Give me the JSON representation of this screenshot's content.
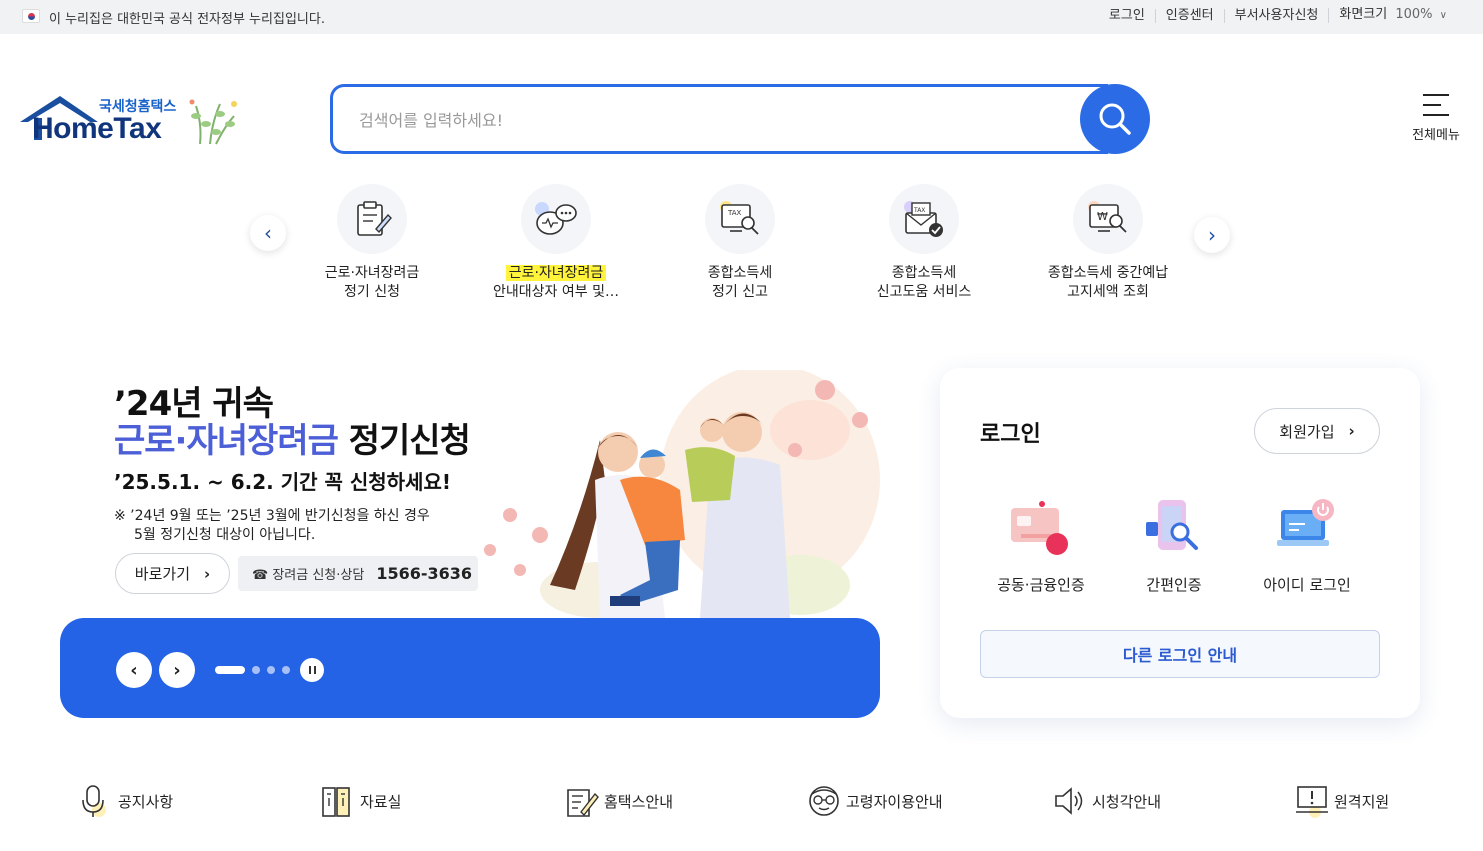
{
  "topbar": {
    "gov_notice": "이 누리집은 대한민국 공식 전자정부 누리집입니다.",
    "links": [
      "로그인",
      "인증센터",
      "부서사용자신청"
    ],
    "screen_size_label": "화면크기",
    "zoom": "100%"
  },
  "logo": {
    "sub": "국세청홈택스",
    "main": "HomeTax"
  },
  "search": {
    "placeholder": "검색어를 입력하세요!",
    "value": ""
  },
  "allmenu": {
    "label": "전체메뉴"
  },
  "quick_menu": [
    {
      "line1": "근로·자녀장려금",
      "line2": "정기 신청"
    },
    {
      "line1": "근로·자녀장려금",
      "line2": "안내대상자 여부 및…"
    },
    {
      "line1": "종합소득세",
      "line2": "정기 신고"
    },
    {
      "line1": "종합소득세",
      "line2": "신고도움 서비스"
    },
    {
      "line1": "종합소득세 중간예납",
      "line2": "고지세액 조회"
    }
  ],
  "banner": {
    "title1": "’24년 귀속",
    "title2_blue": "근로·자녀장려금",
    "title2_black": " 정기신청",
    "period": "’25.5.1. ~ 6.2. 기간 꼭 신청하세요!",
    "note1": "※ ’24년 9월 또는 ’25년 3월에 반기신청을 하신 경우",
    "note2": "5월 정기신청 대상이 아닙니다.",
    "goto_label": "바로가기",
    "phone_label": "☎ 장려금 신청·상담",
    "phone_number": "1566-3636",
    "slide_count": 4,
    "active_slide": 1
  },
  "login": {
    "title": "로그인",
    "join_label": "회원가입",
    "options": [
      {
        "label": "공동·금융인증",
        "icon": "certificate-card-icon"
      },
      {
        "label": "간편인증",
        "icon": "phone-search-icon"
      },
      {
        "label": "아이디 로그인",
        "icon": "laptop-power-icon"
      }
    ],
    "other_label": "다른 로그인 안내"
  },
  "bottom_links": [
    {
      "label": "공지사항",
      "icon": "microphone-icon"
    },
    {
      "label": "자료실",
      "icon": "archive-icon"
    },
    {
      "label": "홈택스안내",
      "icon": "document-pen-icon"
    },
    {
      "label": "고령자이용안내",
      "icon": "elderly-face-icon"
    },
    {
      "label": "시청각안내",
      "icon": "speaker-icon"
    },
    {
      "label": "원격지원",
      "icon": "monitor-remote-icon"
    }
  ],
  "colors": {
    "primary": "#2b6be6",
    "banner_blue": "#2462e6",
    "navy": "#11357d",
    "highlight": "#fff33b"
  }
}
